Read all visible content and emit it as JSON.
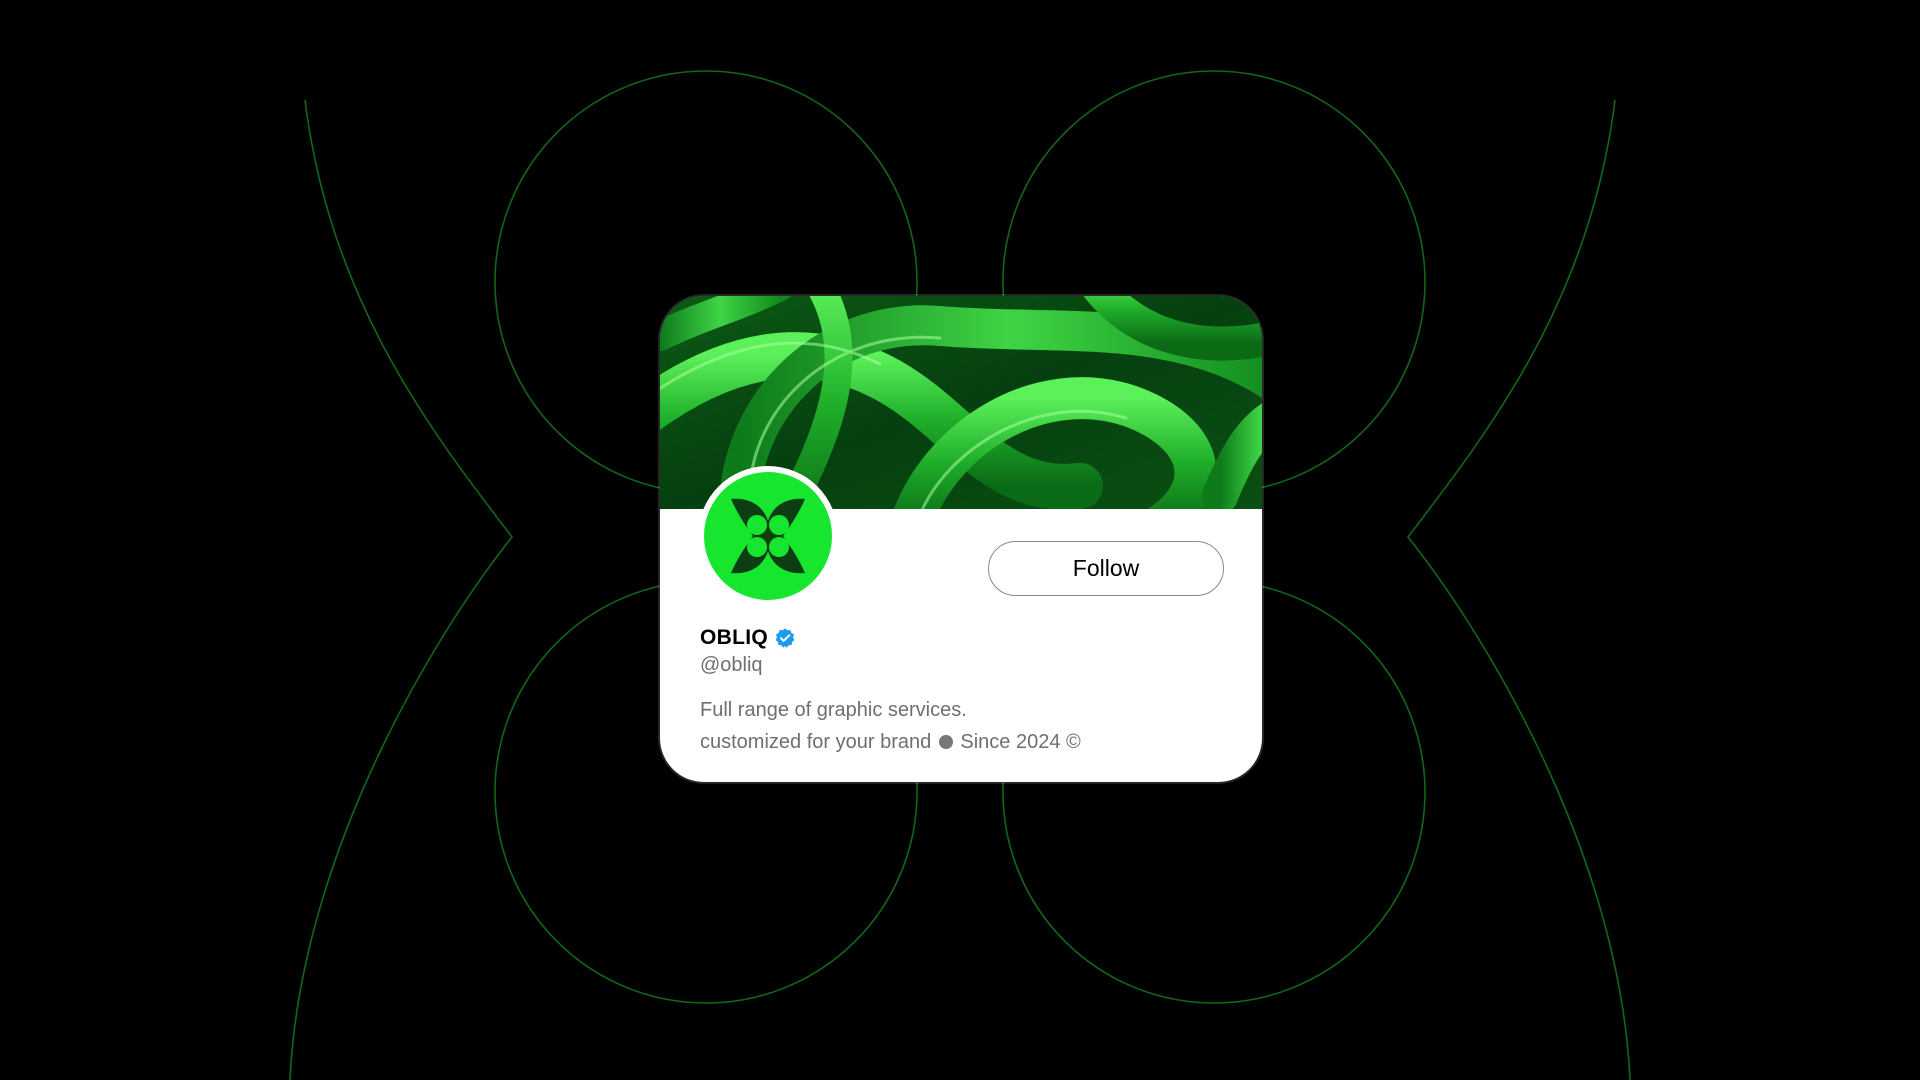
{
  "profile": {
    "display_name": "OBLIQ",
    "handle": "@obliq",
    "verified": true,
    "follow_label": "Follow",
    "bio_line_1": "Full range of graphic services.",
    "bio_line_2_before": "customized for your brand",
    "bio_line_2_after": "Since 2024 ©"
  },
  "icons": {
    "verified": "verified-badge-icon",
    "avatar_logo": "obliq-logo-icon",
    "bio_separator": "dot-icon"
  },
  "colors": {
    "background": "#000000",
    "accent_green": "#17e62e",
    "verified_blue": "#1d9bf0",
    "muted_text": "#6f6f6f",
    "line_green": "#1a7a1f"
  }
}
